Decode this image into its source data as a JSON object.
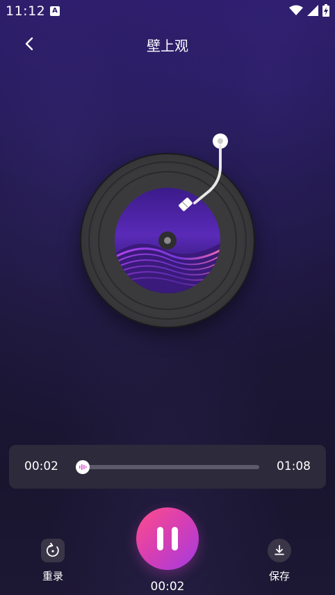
{
  "status_bar": {
    "time": "11:12",
    "notification_icon": "A",
    "icons": [
      "wifi-icon",
      "signal-icon",
      "battery-icon"
    ]
  },
  "header": {
    "title": "壁上观",
    "back_icon": "chevron-left-icon"
  },
  "player": {
    "current_time": "00:02",
    "total_time": "01:08",
    "progress": 0.03,
    "record_time": "00:02"
  },
  "controls": {
    "rerecord_label": "重录",
    "rerecord_icon": "rotate-icon",
    "save_label": "保存",
    "save_icon": "download-icon",
    "pause_icon": "pause-icon"
  },
  "colors": {
    "accent_start": "#ff4f8a",
    "accent_end": "#a43be0",
    "card_bg": "#2d2a3b"
  }
}
